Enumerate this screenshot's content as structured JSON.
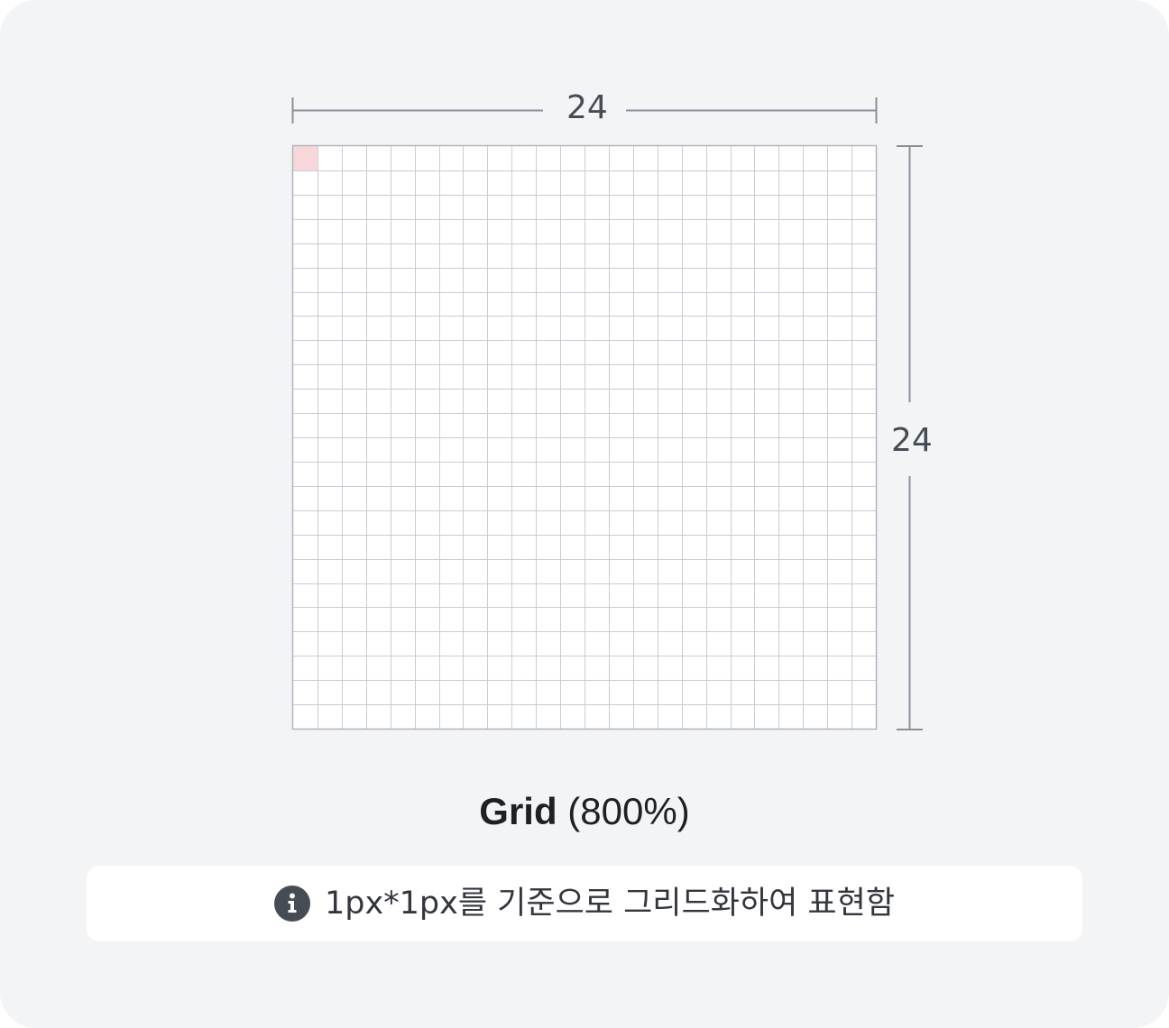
{
  "diagram": {
    "grid_columns": 24,
    "grid_rows": 24,
    "highlighted_cell": {
      "col": 0,
      "row": 0
    },
    "width_label": "24",
    "height_label": "24",
    "colors": {
      "grid_line": "#c9ccd1",
      "grid_border": "#b1b6bc",
      "dimension_line": "#8a9099",
      "highlight": "#f8d7da",
      "grid_fill": "#ffffff"
    }
  },
  "caption": {
    "title": "Grid",
    "scale": "(800%)"
  },
  "note": {
    "icon": "info-icon",
    "text": "1px*1px를 기준으로 그리드화하여 표현함"
  },
  "colors": {
    "card_background": "#f3f4f6",
    "note_background": "#ffffff",
    "text_primary": "#1e2124",
    "text_secondary": "#464c53"
  }
}
